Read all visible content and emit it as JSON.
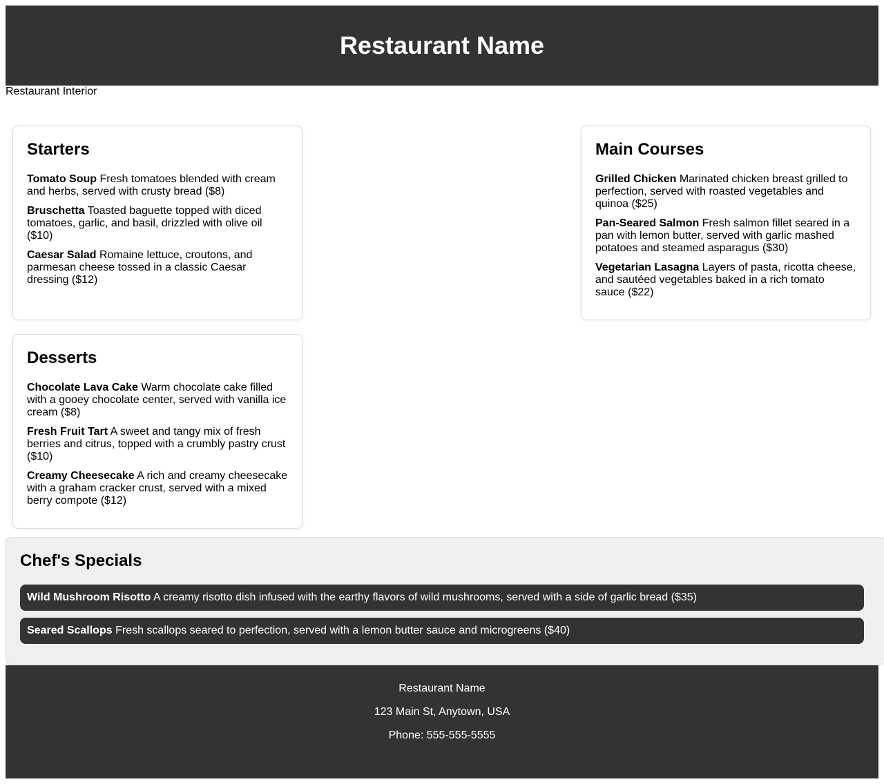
{
  "header": {
    "title": "Restaurant Name"
  },
  "hero": {
    "alt_text": "Restaurant Interior"
  },
  "menu": {
    "starters": {
      "title": "Starters",
      "items": [
        {
          "name": "Tomato Soup",
          "description": "Fresh tomatoes blended with cream and herbs, served with crusty bread ($8)"
        },
        {
          "name": "Bruschetta",
          "description": "Toasted baguette topped with diced tomatoes, garlic, and basil, drizzled with olive oil ($10)"
        },
        {
          "name": "Caesar Salad",
          "description": "Romaine lettuce, croutons, and parmesan cheese tossed in a classic Caesar dressing ($12)"
        }
      ]
    },
    "mains": {
      "title": "Main Courses",
      "items": [
        {
          "name": "Grilled Chicken",
          "description": "Marinated chicken breast grilled to perfection, served with roasted vegetables and quinoa ($25)"
        },
        {
          "name": "Pan-Seared Salmon",
          "description": "Fresh salmon fillet seared in a pan with lemon butter, served with garlic mashed potatoes and steamed asparagus ($30)"
        },
        {
          "name": "Vegetarian Lasagna",
          "description": "Layers of pasta, ricotta cheese, and sautéed vegetables baked in a rich tomato sauce ($22)"
        }
      ]
    },
    "desserts": {
      "title": "Desserts",
      "items": [
        {
          "name": "Chocolate Lava Cake",
          "description": "Warm chocolate cake filled with a gooey chocolate center, served with vanilla ice cream ($8)"
        },
        {
          "name": "Fresh Fruit Tart",
          "description": "A sweet and tangy mix of fresh berries and citrus, topped with a crumbly pastry crust ($10)"
        },
        {
          "name": "Creamy Cheesecake",
          "description": "A rich and creamy cheesecake with a graham cracker crust, served with a mixed berry compote ($12)"
        }
      ]
    }
  },
  "specials": {
    "title": "Chef's Specials",
    "items": [
      {
        "name": "Wild Mushroom Risotto",
        "description": "A creamy risotto dish infused with the earthy flavors of wild mushrooms, served with a side of garlic bread ($35)"
      },
      {
        "name": "Seared Scallops",
        "description": "Fresh scallops seared to perfection, served with a lemon butter sauce and microgreens ($40)"
      }
    ]
  },
  "footer": {
    "name": "Restaurant Name",
    "address": "123 Main St, Anytown, USA",
    "phone": "Phone: 555-555-5555"
  },
  "colors": {
    "header_bg": "#333333",
    "specials_bg": "#efefef",
    "footer_bg": "#333333"
  }
}
